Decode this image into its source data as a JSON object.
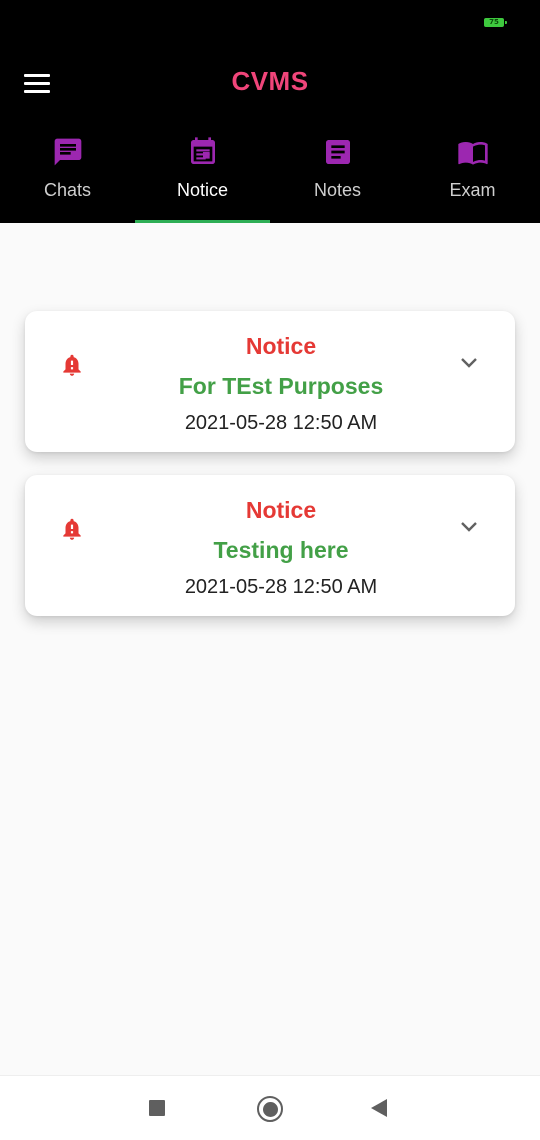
{
  "status_bar": {
    "battery_level": "75"
  },
  "header": {
    "title": "CVMS",
    "title_color": "#f0457a"
  },
  "tabs": [
    {
      "label": "Chats",
      "icon": "chat-icon"
    },
    {
      "label": "Notice",
      "icon": "calendar-icon",
      "active": true
    },
    {
      "label": "Notes",
      "icon": "note-icon"
    },
    {
      "label": "Exam",
      "icon": "book-icon"
    }
  ],
  "colors": {
    "accent_icon": "#9c27b0",
    "active_tab_indicator": "#2eae55",
    "notice_title": "#e53935",
    "notice_body": "#43a047"
  },
  "notices": [
    {
      "title": "Notice",
      "body": "For TEst Purposes",
      "date": "2021-05-28 12:50 AM"
    },
    {
      "title": "Notice",
      "body": "Testing here",
      "date": "2021-05-28 12:50 AM"
    }
  ]
}
